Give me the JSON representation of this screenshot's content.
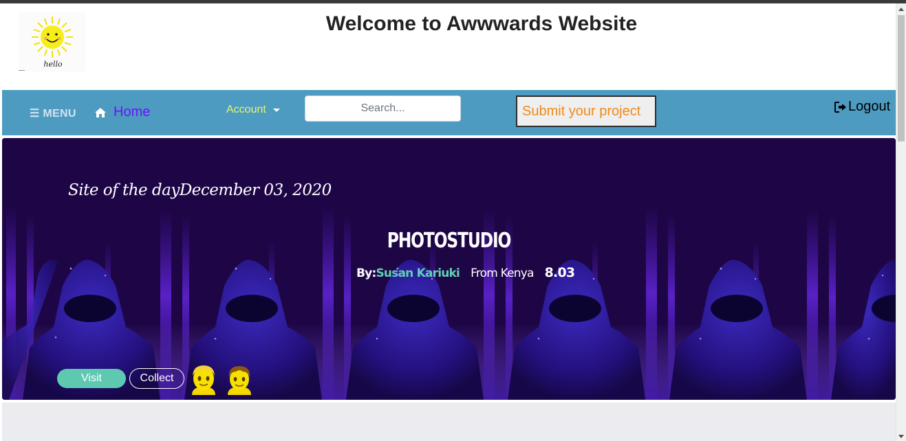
{
  "header": {
    "logo_text": "hello",
    "title": "Welcome to Awwwards Website"
  },
  "navbar": {
    "menu_label": "☰ MENU",
    "home_label": "Home",
    "account_label": "Account",
    "search_placeholder": "Search...",
    "submit_label": "Submit your project",
    "logout_label": "Logout"
  },
  "hero": {
    "site_of_day": "Site of the dayDecember 03, 2020",
    "project_title": "PHOTOSTUDIO",
    "by_label": "By:",
    "author": "Susan Kariuki",
    "from_label": "From Kenya",
    "score": "8.03",
    "visit_label": "Visit",
    "collect_label": "Collect",
    "avatars": [
      "blond-person-avatar",
      "person-avatar"
    ]
  },
  "colors": {
    "navbar_bg": "#4e9bc1",
    "hero_bg": "#1e0646",
    "accent_teal": "#5ec9b0",
    "home_link": "#6a12ff",
    "account_link": "#e6f570",
    "submit_text": "#f0891a"
  },
  "icons": {
    "home": "home-icon",
    "logout": "sign-out-icon",
    "caret": "caret-down-icon"
  }
}
